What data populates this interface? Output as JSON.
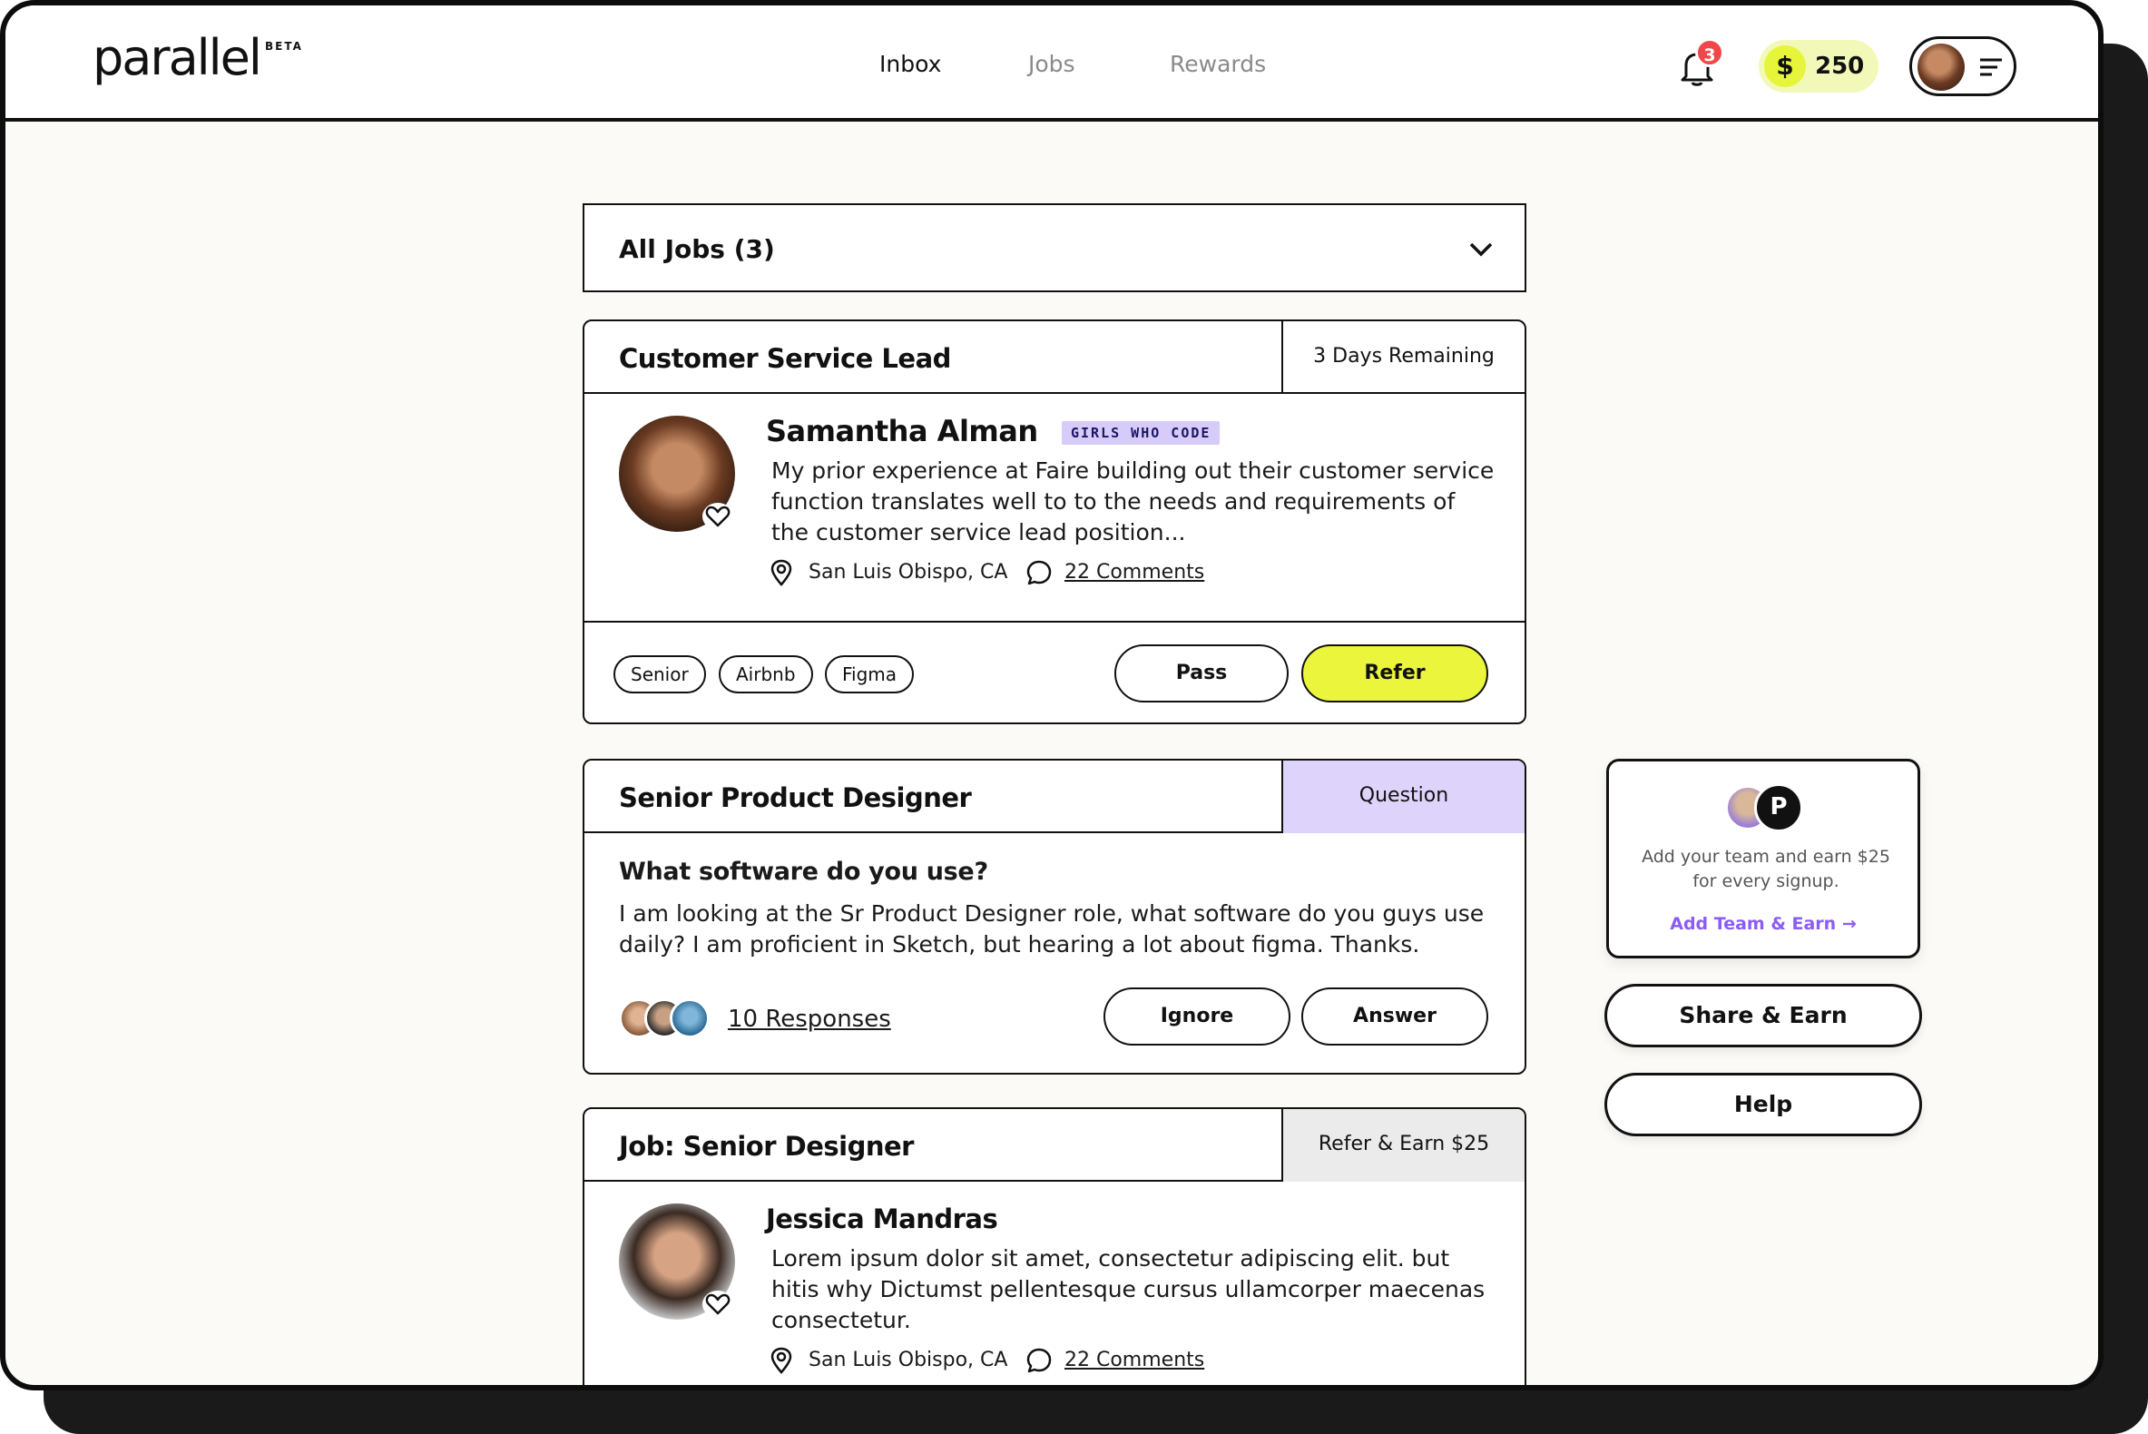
{
  "header": {
    "logo": "parallel",
    "beta": "BETA",
    "nav": [
      "Inbox",
      "Jobs",
      "Rewards"
    ],
    "active_nav": "Inbox",
    "notification_count": "3",
    "points": "250",
    "coin_symbol": "$"
  },
  "filter": {
    "label": "All Jobs (3)"
  },
  "cards": [
    {
      "title": "Customer Service Lead",
      "tag": "3 Days Remaining",
      "name": "Samantha Alman",
      "org": "GIRLS WHO CODE",
      "text": "My prior experience at Faire building out their customer service function translates well to to the needs and requirements of the customer service lead position...",
      "location": "San Luis Obispo, CA",
      "comments": "22 Comments",
      "skills": [
        "Senior",
        "Airbnb",
        "Figma"
      ],
      "secondary_btn": "Pass",
      "primary_btn": "Refer"
    },
    {
      "title": "Senior Product Designer",
      "tag": "Question",
      "question": "What software do you use?",
      "text": "I am looking at the Sr Product Designer role, what software do you guys use daily? I am proficient in Sketch, but hearing a lot about figma. Thanks.",
      "responses": "10 Responses",
      "secondary_btn": "Ignore",
      "primary_btn": "Answer"
    },
    {
      "title": "Job: Senior Designer",
      "tag": "Refer & Earn $25",
      "name": "Jessica Mandras",
      "text": "Lorem ipsum dolor sit amet, consectetur adipiscing elit.  but hitis why Dictumst pellentesque cursus ullamcorper maecenas consectetur.",
      "location": "San Luis Obispo, CA",
      "comments": "22 Comments"
    }
  ],
  "sidebar": {
    "promo_logo_letter": "P",
    "promo_text": "Add your team and earn $25 for every signup.",
    "promo_link": "Add Team & Earn →",
    "share_btn": "Share & Earn",
    "help_btn": "Help"
  },
  "colors": {
    "accent_yellow": "#eaf53b",
    "accent_purple": "#ddd3fb",
    "badge_red": "#f0474a",
    "link_purple": "#8b5cf6"
  }
}
